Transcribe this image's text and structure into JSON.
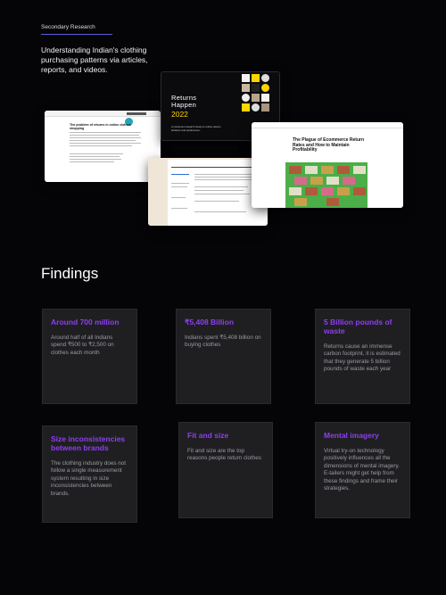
{
  "header": {
    "section_label": "Secondary Research",
    "intro": "Understanding Indian's clothing purchasing patterns via articles, reports, and videos."
  },
  "collage": {
    "report_title_line1": "Returns",
    "report_title_line2": "Happen",
    "report_year": "2022",
    "report_desc": "A consumer research study on online returns behavior and preferences.",
    "article_title": "The Plague of Ecommerce Return Rates and How to Maintain Profitability",
    "blog_headline": "The problem of returns in online clothes shopping",
    "accent_yellow": "#ffd400",
    "article_image_green": "#4cae48"
  },
  "findings": {
    "title": "Findings",
    "accent": "#8d3ff0",
    "cards": [
      {
        "heading": "Around 700 million",
        "body": "Around half of all Indians spend ₹500 to ₹2,500 on clothes each month"
      },
      {
        "heading": "₹5,408 Billion",
        "body": "Indians spent ₹5,408 billion on buying clothes"
      },
      {
        "heading": "5 Billion pounds of waste",
        "body": "Returns cause an immense carbon footprint, it is estimated that they generate 5 billion pounds of waste each year"
      },
      {
        "heading": "Size inconsistencies between brands",
        "body": "The clothing industry does not follow a single measurement system resulting in size inconsistencies between brands."
      },
      {
        "heading": "Fit and size",
        "body": "Fit and size are the top reasons people return clothes"
      },
      {
        "heading": "Mental imagery",
        "body": "Virtual try-on technology positively influences all the dimensions of mental imagery. E-tailers might get help from these findings and frame their strategies."
      }
    ]
  }
}
